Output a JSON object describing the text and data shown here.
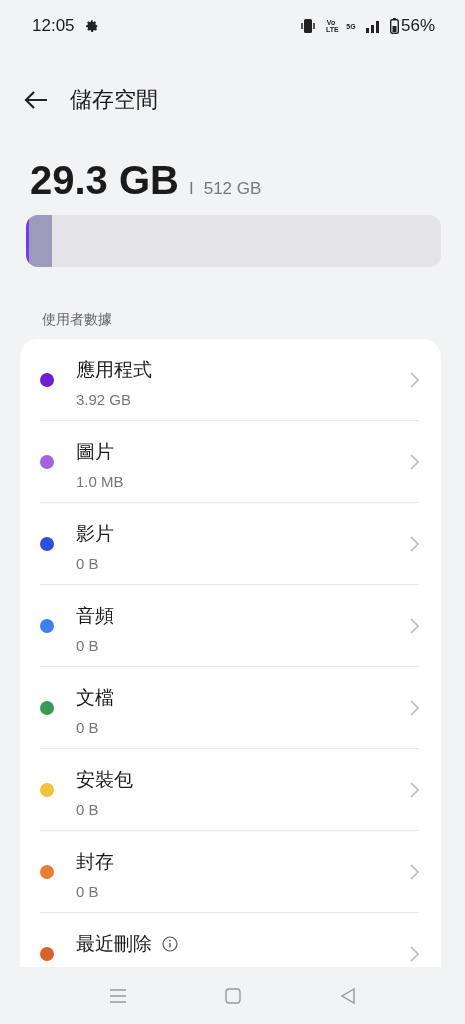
{
  "status_bar": {
    "time": "12:05",
    "volte": "Vo LTE",
    "network": "5G",
    "battery": "56%"
  },
  "header": {
    "title": "儲存空間"
  },
  "summary": {
    "used": "29.3 GB",
    "separator": "I",
    "total": "512 GB"
  },
  "usage_bar": {
    "segments": [
      {
        "color": "#7a3be6",
        "level": 0.007
      },
      {
        "color": "#9c9bbb",
        "level": 0.056
      }
    ]
  },
  "section": {
    "label": "使用者數據"
  },
  "items": [
    {
      "name": "應用程式",
      "size": "3.92 GB",
      "color": "#6a1fd0",
      "info": false
    },
    {
      "name": "圖片",
      "size": "1.0 MB",
      "color": "#a463e0",
      "info": false
    },
    {
      "name": "影片",
      "size": "0 B",
      "color": "#2b4fe0",
      "info": false
    },
    {
      "name": "音頻",
      "size": "0 B",
      "color": "#3b82f0",
      "info": false
    },
    {
      "name": "文檔",
      "size": "0 B",
      "color": "#3a9a55",
      "info": false
    },
    {
      "name": "安裝包",
      "size": "0 B",
      "color": "#f2c23a",
      "info": false
    },
    {
      "name": "封存",
      "size": "0 B",
      "color": "#ea7d35",
      "info": false
    },
    {
      "name": "最近刪除",
      "color": "#d9622b",
      "info": true
    }
  ]
}
